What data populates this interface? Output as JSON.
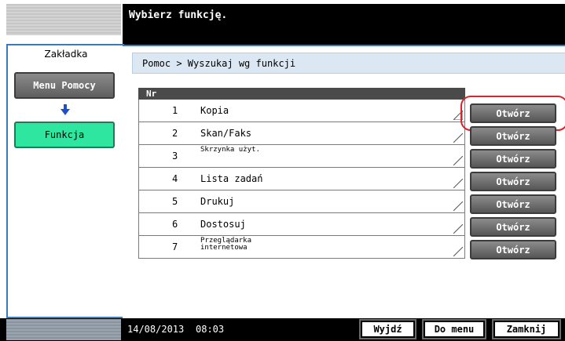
{
  "header": {
    "title": "Wybierz funkcję."
  },
  "sidebar": {
    "title": "Zakładka",
    "menu_button": "Menu Pomocy",
    "function_button": "Funkcja"
  },
  "breadcrumb": "Pomoc > Wyszukaj wg funkcji",
  "table": {
    "header": "Nr",
    "open_label": "Otwórz",
    "rows": [
      {
        "num": "1",
        "label": "Kopia"
      },
      {
        "num": "2",
        "label": "Skan/Faks"
      },
      {
        "num": "3",
        "label": "Skrzynka użyt."
      },
      {
        "num": "4",
        "label": "Lista zadań"
      },
      {
        "num": "5",
        "label": "Drukuj"
      },
      {
        "num": "6",
        "label": "Dostosuj"
      },
      {
        "num": "7",
        "label": "Przeglądarka internetowa"
      }
    ]
  },
  "footer": {
    "date": "14/08/2013",
    "time": "08:03",
    "exit": "Wyjdź",
    "to_menu": "Do menu",
    "close": "Zamknij"
  },
  "colors": {
    "accent_blue": "#3a7ab8",
    "active_tab": "#2ee6a0",
    "highlight": "#d8242c"
  }
}
